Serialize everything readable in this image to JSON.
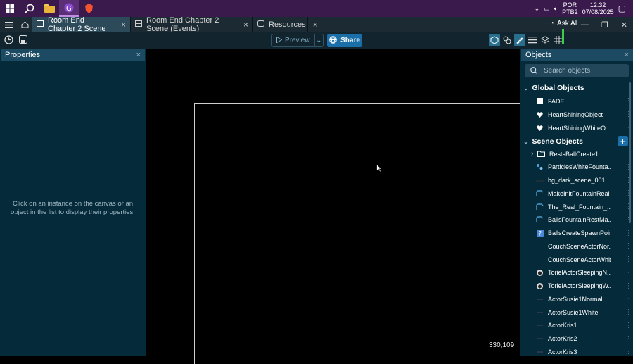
{
  "tray": {
    "lang_top": "POR",
    "lang_bottom": "PTB2",
    "time": "12:32",
    "date": "07/08/2025"
  },
  "tabs": [
    {
      "label": "Room End Chapter 2 Scene",
      "icon": "scene-icon",
      "active": true
    },
    {
      "label": "Room End Chapter 2 Scene (Events)",
      "icon": "events-icon",
      "active": false
    },
    {
      "label": "Resources",
      "icon": "resources-icon",
      "active": false
    }
  ],
  "ask_ai": "Ask AI",
  "toolbar": {
    "preview_label": "Preview",
    "share_label": "Share"
  },
  "properties": {
    "title": "Properties",
    "hint": "Click on an instance on the canvas or an object in the list to display their properties."
  },
  "canvas": {
    "coords": "330,109"
  },
  "objects": {
    "title": "Objects",
    "search_placeholder": "Search objects",
    "global_title": "Global Objects",
    "global_items": [
      "FADE",
      "HeartShiningObject",
      "HeartShiningWhiteO..."
    ],
    "scene_title": "Scene Objects",
    "scene_items": [
      "RestsBallCreate1",
      "ParticlesWhiteFounta...",
      "bg_dark_scene_001",
      "MakeInitFountainReal",
      "The_Real_Fountain_...",
      "BallsFountainRestMa...",
      "BallsCreateSpawnPoint",
      "CouchSceneActorNor...",
      "CouchSceneActorWhite",
      "TorielActorSleepingN...",
      "TorielActorSleepingW...",
      "ActorSusie1Normal",
      "ActorSusie1White",
      "ActorKris1",
      "ActorKris2",
      "ActorKris3"
    ]
  },
  "colors": {
    "accent": "#1b6fa8",
    "panel": "#052b3b",
    "header": "#1d4a63"
  }
}
